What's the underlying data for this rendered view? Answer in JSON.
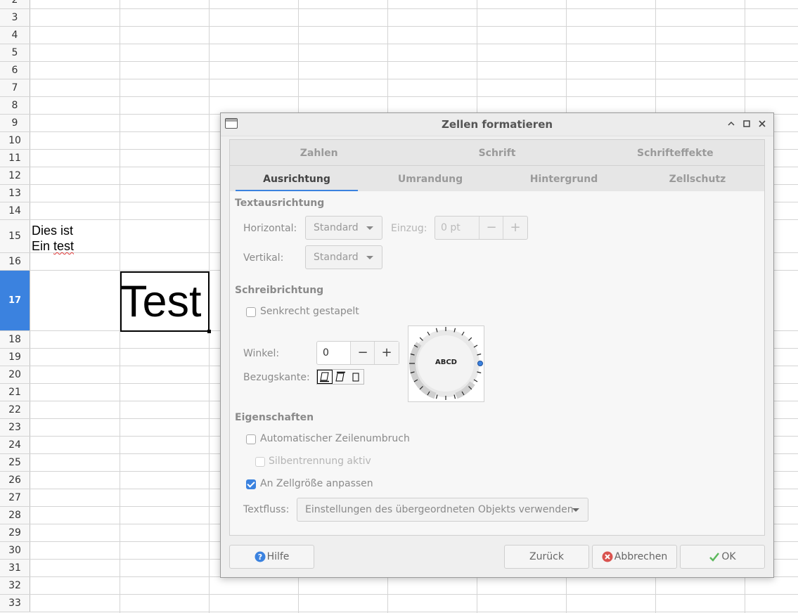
{
  "sheet": {
    "row_numbers": [
      "2",
      "3",
      "4",
      "5",
      "6",
      "7",
      "8",
      "9",
      "10",
      "11",
      "12",
      "13",
      "14",
      "15",
      "16",
      "17",
      "18",
      "19",
      "20",
      "21",
      "22",
      "23",
      "24",
      "25",
      "26",
      "27",
      "28",
      "29",
      "30",
      "31",
      "32",
      "33"
    ],
    "selected_row": "17",
    "a15_line1": "Dies ist",
    "a15_line2_prefix": "Ein ",
    "a15_line2_word": "test",
    "b17_text": "Test"
  },
  "dialog": {
    "title": "Zellen formatieren",
    "tabs_row1": [
      "Zahlen",
      "Schrift",
      "Schrifteffekte"
    ],
    "tabs_row2": [
      "Ausrichtung",
      "Umrandung",
      "Hintergrund",
      "Zellschutz"
    ],
    "active_tab": "Ausrichtung",
    "textausrichtung": {
      "heading": "Textausrichtung",
      "horizontal_label": "Horizontal:",
      "horizontal_value": "Standard",
      "einzug_label": "Einzug:",
      "einzug_value": "0 pt",
      "vertikal_label": "Vertikal:",
      "vertikal_value": "Standard"
    },
    "schreibrichtung": {
      "heading": "Schreibrichtung",
      "senkrecht_label": "Senkrecht gestapelt",
      "senkrecht_checked": false,
      "winkel_label": "Winkel:",
      "winkel_value": "0",
      "bezugskante_label": "Bezugskante:",
      "dial_text": "ABCD"
    },
    "eigenschaften": {
      "heading": "Eigenschaften",
      "umbruch_label": "Automatischer Zeilenumbruch",
      "umbruch_checked": false,
      "silben_label": "Silbentrennung aktiv",
      "silben_checked": false,
      "anpassen_label": "An Zellgröße anpassen",
      "anpassen_checked": true,
      "textfluss_label": "Textfluss:",
      "textfluss_value": "Einstellungen des übergeordneten Objekts verwenden"
    },
    "buttons": {
      "help": "Hilfe",
      "back": "Zurück",
      "cancel": "Abbrechen",
      "ok": "OK"
    },
    "colors": {
      "accent": "#3b82df",
      "cancel_red": "#d9534f",
      "ok_green": "#5cb85c",
      "help_blue": "#3b82df"
    }
  }
}
